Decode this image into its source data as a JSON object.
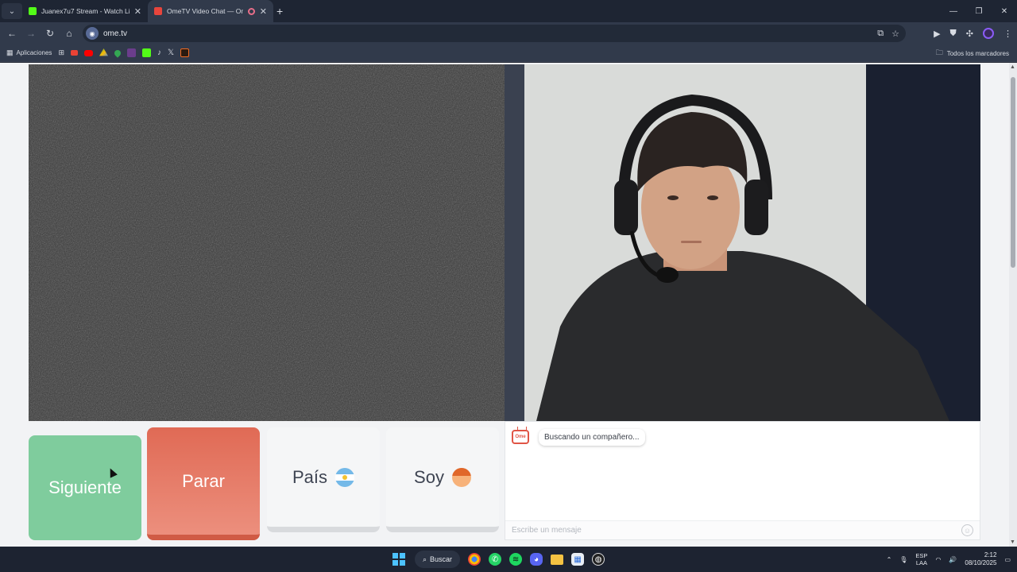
{
  "browser": {
    "tabs": [
      {
        "title": "Juanex7u7 Stream - Watch Live",
        "active": false,
        "favicon_color": "#53fc18"
      },
      {
        "title": "OmeTV Video Chat — Ome",
        "active": true,
        "favicon_color": "#e8453c"
      }
    ],
    "url": "ome.tv",
    "bookmarks": {
      "apps_label": "Aplicaciones",
      "all_label": "Todos los marcadores"
    }
  },
  "controls": {
    "next_label": "Siguiente",
    "stop_label": "Parar",
    "country_label": "País",
    "me_label": "Soy"
  },
  "chat": {
    "status_message": "Buscando un compañero...",
    "logo_text": "Ome",
    "input_placeholder": "Escribe un mensaje"
  },
  "taskbar": {
    "search_label": "Buscar",
    "lang_line1": "ESP",
    "lang_line2": "LAA",
    "time": "2:12",
    "date": "08/10/2025"
  },
  "colors": {
    "next_button": "#7fcc9d",
    "stop_button": "#e06a55",
    "browser_bg": "#313a4b"
  }
}
